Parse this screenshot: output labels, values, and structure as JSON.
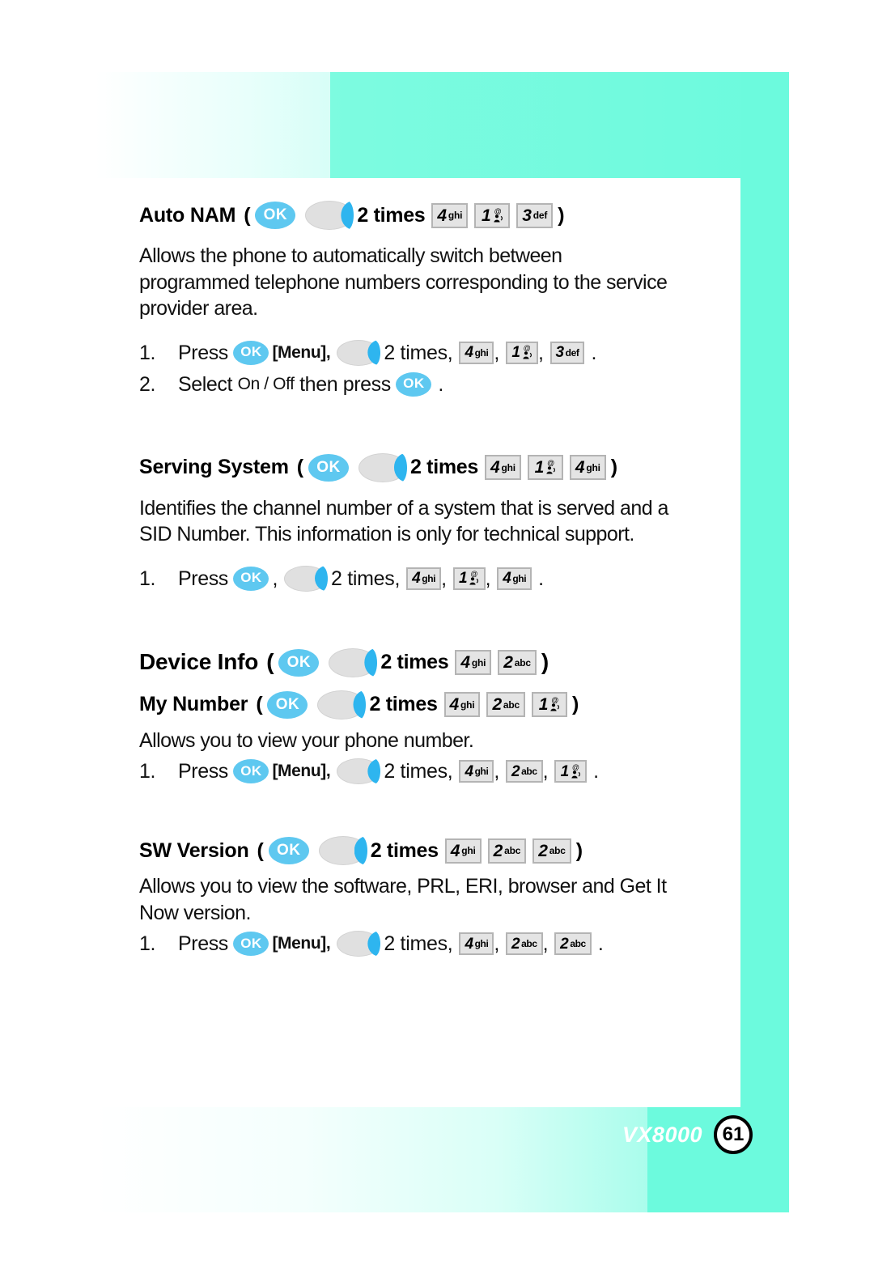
{
  "footer": {
    "brand": "VX8000",
    "page_number": "61"
  },
  "colors": {
    "teal_band": "#6cfadd",
    "ok_button": "#5ec8f0",
    "nav_arrow": "#2eb5ef",
    "key_face": "#e4e4e4",
    "key_border": "#b4b4b4"
  },
  "icons": {
    "ok_label": "OK",
    "nav_right_name": "nav-right-arrow",
    "key_1_at": "@"
  },
  "common": {
    "open_paren": "(",
    "close_paren": ")",
    "two_times": "2 times",
    "two_times_comma": "2 times,",
    "press": "Press",
    "menu": "[Menu]",
    "comma": ",",
    "period": ".",
    "select_prefix": "Select",
    "on_off": "On / Off",
    "then_press": "then press"
  },
  "sections": [
    {
      "id": "auto-nam",
      "heading": "Auto NAM",
      "heading_keys": [
        {
          "digit": "4",
          "letters": "ghi"
        },
        {
          "digit": "1",
          "letters": "voicemail"
        },
        {
          "digit": "3",
          "letters": "def"
        }
      ],
      "description": "Allows the phone to automatically switch between programmed telephone numbers corresponding to the service provider area.",
      "description_lines": [
        "Allows the phone to automatically switch between",
        "programmed telephone numbers corresponding to the service",
        "provider area."
      ],
      "steps": [
        {
          "number": "1.",
          "has_menu": true,
          "keys": [
            {
              "digit": "4",
              "letters": "ghi"
            },
            {
              "digit": "1",
              "letters": "voicemail"
            },
            {
              "digit": "3",
              "letters": "def"
            }
          ]
        },
        {
          "number": "2.",
          "type": "select",
          "text_before": "Select",
          "option": "On / Off",
          "text_after": "then press"
        }
      ]
    },
    {
      "id": "serving-system",
      "heading": "Serving System",
      "heading_keys": [
        {
          "digit": "4",
          "letters": "ghi"
        },
        {
          "digit": "1",
          "letters": "voicemail"
        },
        {
          "digit": "4",
          "letters": "ghi"
        }
      ],
      "description_lines": [
        "Identifies the channel number of a system that is served and a",
        "SID Number. This information is only for technical support."
      ],
      "steps": [
        {
          "number": "1.",
          "has_menu": false,
          "keys": [
            {
              "digit": "4",
              "letters": "ghi"
            },
            {
              "digit": "1",
              "letters": "voicemail"
            },
            {
              "digit": "4",
              "letters": "ghi"
            }
          ]
        }
      ]
    },
    {
      "id": "device-info",
      "heading": "Device Info",
      "large": true,
      "heading_keys": [
        {
          "digit": "4",
          "letters": "ghi"
        },
        {
          "digit": "2",
          "letters": "abc"
        }
      ]
    },
    {
      "id": "my-number",
      "heading": "My Number",
      "heading_keys": [
        {
          "digit": "4",
          "letters": "ghi"
        },
        {
          "digit": "2",
          "letters": "abc"
        },
        {
          "digit": "1",
          "letters": "voicemail"
        }
      ],
      "description_lines": [
        "Allows you to view your phone number."
      ],
      "steps": [
        {
          "number": "1.",
          "has_menu": true,
          "keys": [
            {
              "digit": "4",
              "letters": "ghi"
            },
            {
              "digit": "2",
              "letters": "abc"
            },
            {
              "digit": "1",
              "letters": "voicemail"
            }
          ]
        }
      ]
    },
    {
      "id": "sw-version",
      "heading": "SW Version",
      "heading_keys": [
        {
          "digit": "4",
          "letters": "ghi"
        },
        {
          "digit": "2",
          "letters": "abc"
        },
        {
          "digit": "2",
          "letters": "abc"
        }
      ],
      "description_lines": [
        "Allows you to view the software, PRL, ERI, browser and Get It",
        "Now version."
      ],
      "steps": [
        {
          "number": "1.",
          "has_menu": true,
          "keys": [
            {
              "digit": "4",
              "letters": "ghi"
            },
            {
              "digit": "2",
              "letters": "abc"
            },
            {
              "digit": "2",
              "letters": "abc"
            }
          ]
        }
      ]
    }
  ]
}
